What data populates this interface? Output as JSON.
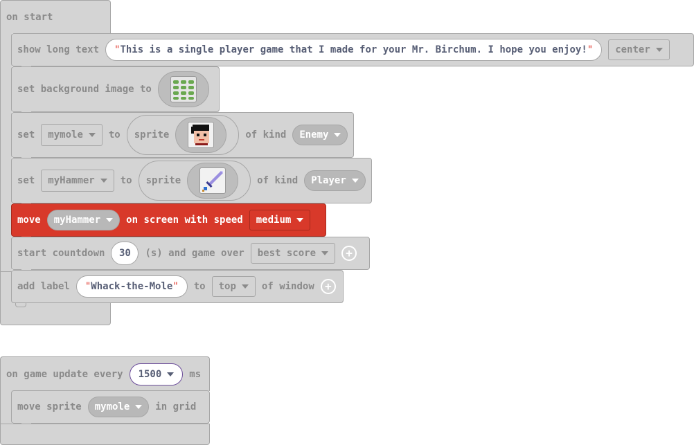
{
  "on_start": {
    "label": "on start",
    "show_long_text": {
      "label": "show long text",
      "text": "This is a single player game that I made for your Mr. Birchum. I hope you enjoy!",
      "position": "center"
    },
    "set_background": {
      "label": "set background image to",
      "image_icon": "mole-holes-grid-icon"
    },
    "set_mymole": {
      "set_label": "set",
      "variable": "mymole",
      "to_label": "to",
      "sprite_label": "sprite",
      "of_kind_label": "of kind",
      "kind": "Enemy",
      "image_icon": "pixel-face-icon"
    },
    "set_myhammer": {
      "set_label": "set",
      "variable": "myHammer",
      "to_label": "to",
      "sprite_label": "sprite",
      "of_kind_label": "of kind",
      "kind": "Player",
      "image_icon": "pixel-sword-icon"
    },
    "move_block": {
      "move_label": "move",
      "variable": "myHammer",
      "middle_label": "on screen with speed",
      "speed": "medium"
    },
    "countdown": {
      "label": "start countdown",
      "value": "30",
      "middle_label": "(s) and game over",
      "game_over_mode": "best score"
    },
    "add_label": {
      "label": "add label",
      "text": "Whack-the-Mole",
      "to_label": "to",
      "position": "top",
      "suffix": "of window"
    }
  },
  "on_update": {
    "label": "on game update every",
    "interval": "1500",
    "unit": "ms",
    "move_sprite": {
      "label": "move sprite",
      "variable": "mymole",
      "suffix": "in grid"
    }
  },
  "colors": {
    "block_gray": "#d4d4d4",
    "block_border": "#a6a6a6",
    "move_red": "#d8392a",
    "text_gray": "#8a8a8a",
    "quote_red": "#e0352b"
  }
}
